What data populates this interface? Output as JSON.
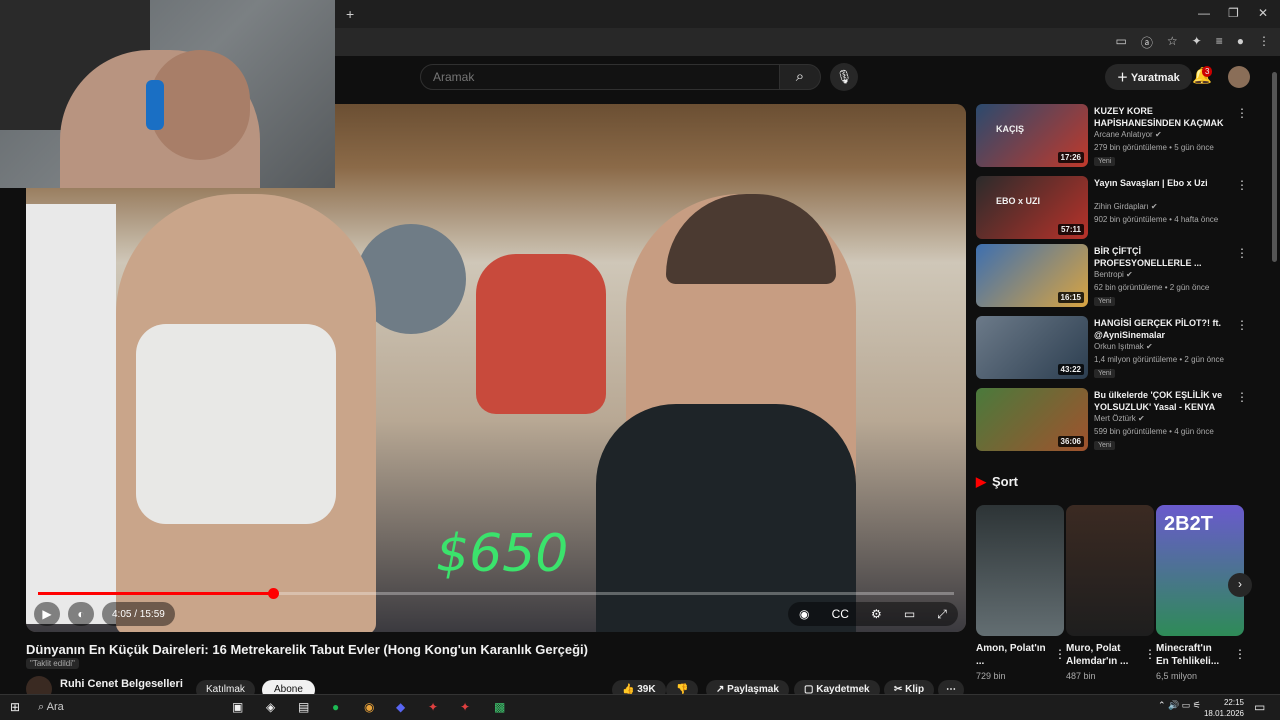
{
  "browser": {
    "new_tab_label": "+",
    "minimize": "—",
    "restore": "❐",
    "close": "✕"
  },
  "header": {
    "search_placeholder": "Aramak",
    "create_label": "Yaratmak",
    "notifications_count": "3"
  },
  "player": {
    "time_display": "4:05 / 15:59",
    "progress_fraction": 0.257,
    "overlay_text": "$650"
  },
  "video": {
    "title": "Dünyanın En Küçük Daireleri: 16 Metrekarelik Tabut Evler (Hong Kong'un Karanlık Gerçeği)",
    "tag": "\"Taklit edildi\"",
    "channel": "Ruhi Cenet Belgeselleri",
    "join_label": "Katılmak",
    "subscribe_label": "Abone",
    "like_count": "39K",
    "share_label": "Paylaşmak",
    "save_label": "Kaydetmek",
    "clip_label": "Klip"
  },
  "recommendations": [
    {
      "title": "KUZEY KORE HAPİSHANESİNDEN KAÇMAK",
      "channel": "Arcane Anlatıyor",
      "meta": "279 bin görüntüleme • 5 gün önce",
      "badge": "Yeni",
      "duration": "17:26",
      "thumb_text": "KAÇIŞ",
      "color1": "#2b4a6e",
      "color2": "#c0392b"
    },
    {
      "title": "Yayın Savaşları | Ebo x Uzi",
      "channel": "Zihin Girdapları",
      "meta": "902 bin görüntüleme • 4 hafta önce",
      "badge": "",
      "duration": "57:11",
      "thumb_text": "EBO x UZI",
      "color1": "#2b2b2b",
      "color2": "#b8322a"
    },
    {
      "title": "BİR ÇİFTÇİ PROFESYONELLERLE ...",
      "channel": "Bentropi",
      "meta": "62 bin görüntüleme • 2 gün önce",
      "badge": "Yeni",
      "duration": "16:15",
      "thumb_text": "",
      "color1": "#3d6fb0",
      "color2": "#d9a441"
    },
    {
      "title": "HANGİSİ GERÇEK PİLOT?! ft. @AyniSinemalar",
      "channel": "Orkun Işıtmak",
      "meta": "1,4 milyon görüntüleme • 2 gün önce",
      "badge": "Yeni",
      "duration": "43:22",
      "thumb_text": "",
      "color1": "#6c7a89",
      "color2": "#2c3e50"
    },
    {
      "title": "Bu ülkelerde 'ÇOK EŞLİLİK ve YOLSUZLUK' Yasal - KENYA",
      "channel": "Mert Öztürk",
      "meta": "599 bin görüntüleme • 4 gün önce",
      "badge": "Yeni",
      "duration": "36:06",
      "thumb_text": "",
      "color1": "#4a7a3c",
      "color2": "#a0522d"
    }
  ],
  "shorts": {
    "heading": "Şort",
    "items": [
      {
        "title": "Amon, Polat'ın ...",
        "views": "729 bin",
        "thumb_text": "",
        "color1": "#2d3436",
        "color2": "#636e72"
      },
      {
        "title": "Muro, Polat Alemdar'ın ...",
        "views": "487 bin",
        "thumb_text": "",
        "color1": "#3b2a22",
        "color2": "#1e1e1e"
      },
      {
        "title": "Minecraft'ın En Tehlikeli...",
        "views": "6,5 milyon",
        "thumb_text": "2B2T",
        "color1": "#6a5acd",
        "color2": "#2e8b57"
      }
    ]
  },
  "taskbar": {
    "search_label": "Ara",
    "time": "22:15",
    "date": "18.01.2026"
  },
  "colors": {
    "accent": "#ff0000",
    "background": "#0f0f0f",
    "overlay_green": "#3be36c"
  }
}
